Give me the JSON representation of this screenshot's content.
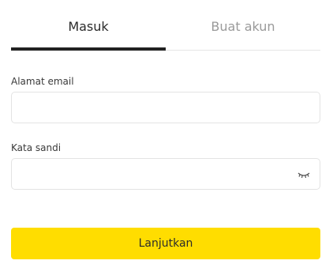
{
  "tabs": [
    {
      "label": "Masuk",
      "active": true
    },
    {
      "label": "Buat akun",
      "active": false
    }
  ],
  "email": {
    "label": "Alamat email",
    "value": "",
    "placeholder": ""
  },
  "password": {
    "label": "Kata sandi",
    "value": "",
    "placeholder": "",
    "toggle_icon": "eye-closed-icon"
  },
  "submit": {
    "label": "Lanjutkan"
  },
  "colors": {
    "accent": "#ffdd00",
    "active_underline": "#222222",
    "inactive_tab_text": "#9a9a9a"
  }
}
